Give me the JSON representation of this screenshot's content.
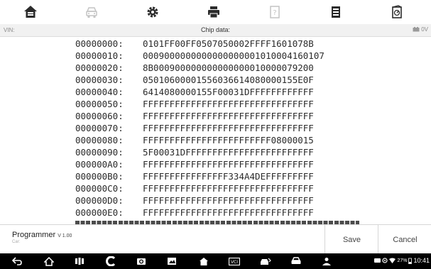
{
  "toolbar": {
    "items": [
      {
        "icon": "home-icon",
        "state": "enabled"
      },
      {
        "icon": "vehicle-icon",
        "state": "disabled"
      },
      {
        "icon": "settings-icon",
        "state": "enabled"
      },
      {
        "icon": "print-icon",
        "state": "enabled"
      },
      {
        "icon": "help-icon",
        "state": "disabled"
      },
      {
        "icon": "data-log-icon",
        "state": "enabled"
      },
      {
        "icon": "exit-icon",
        "state": "enabled"
      }
    ]
  },
  "status": {
    "vin_label": "VIN:",
    "title": "Chip data:",
    "voltage": "0V"
  },
  "hex": {
    "rows": [
      {
        "addr": "00000000:",
        "data": "0101FF00FF0507050002FFFF1601078B"
      },
      {
        "addr": "00000010:",
        "data": "0009000000000000000001010004160107"
      },
      {
        "addr": "00000020:",
        "data": "8B000900000000000000010000079200"
      },
      {
        "addr": "00000030:",
        "data": "05010600001556036614080000155E0F"
      },
      {
        "addr": "00000040:",
        "data": "6414080000155F00031DFFFFFFFFFFFF"
      },
      {
        "addr": "00000050:",
        "data": "FFFFFFFFFFFFFFFFFFFFFFFFFFFFFFFF"
      },
      {
        "addr": "00000060:",
        "data": "FFFFFFFFFFFFFFFFFFFFFFFFFFFFFFFF"
      },
      {
        "addr": "00000070:",
        "data": "FFFFFFFFFFFFFFFFFFFFFFFFFFFFFFFF"
      },
      {
        "addr": "00000080:",
        "data": "FFFFFFFFFFFFFFFFFFFFFFFF08000015"
      },
      {
        "addr": "00000090:",
        "data": "5F00031DFFFFFFFFFFFFFFFFFFFFFFFF"
      },
      {
        "addr": "000000A0:",
        "data": "FFFFFFFFFFFFFFFFFFFFFFFFFFFFFFFF"
      },
      {
        "addr": "000000B0:",
        "data": "FFFFFFFFFFFFFFFF334A4DEFFFFFFFFF"
      },
      {
        "addr": "000000C0:",
        "data": "FFFFFFFFFFFFFFFFFFFFFFFFFFFFFFFF"
      },
      {
        "addr": "000000D0:",
        "data": "FFFFFFFFFFFFFFFFFFFFFFFFFFFFFFFF"
      },
      {
        "addr": "000000E0:",
        "data": "FFFFFFFFFFFFFFFFFFFFFFFFFFFFFFFF"
      }
    ]
  },
  "footer": {
    "app_name": "Programmer",
    "version": "V 1.00",
    "car_label": "Car:",
    "save_label": "Save",
    "cancel_label": "Cancel"
  },
  "system": {
    "battery": "27%",
    "time": "10:41"
  },
  "colors": {
    "icon_dark": "#2b2b2b",
    "icon_disabled": "#c4c4c4",
    "status_bg": "#f1f1f1"
  }
}
